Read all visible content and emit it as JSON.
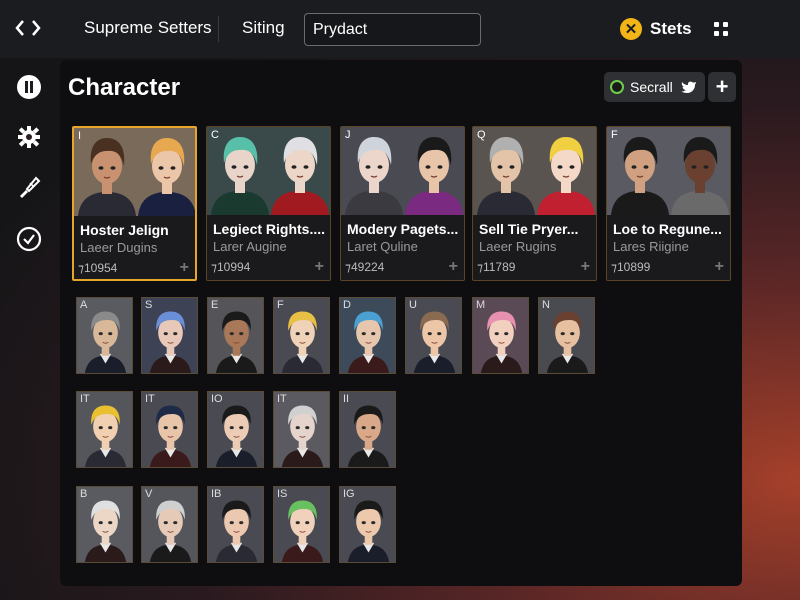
{
  "topbar": {
    "tabs": [
      {
        "label": "Supreme Setters"
      },
      {
        "label": "Siting"
      }
    ],
    "search_value": "Prydact",
    "stats_label": "Stets",
    "stats_icon": "x-circle-icon"
  },
  "sidebar": {
    "items": [
      {
        "icon": "pause-icon"
      },
      {
        "icon": "gear-icon"
      },
      {
        "icon": "brush-icon"
      },
      {
        "icon": "check-circle-icon"
      }
    ]
  },
  "panel": {
    "title": "Character",
    "search_chip_label": "Secrall",
    "add_label": "+"
  },
  "featured": [
    {
      "letter": "I",
      "title": "Hoster Jelign",
      "subtitle": "Laeer Dugins",
      "count": "⁊10954",
      "plus": "+"
    },
    {
      "letter": "C",
      "title": "Legiect Rights....",
      "subtitle": "Larer Augine",
      "count": "⁊10994",
      "plus": "+"
    },
    {
      "letter": "J",
      "title": "Modery Pagets...",
      "subtitle": "Laret Quline",
      "count": "⁊49224",
      "plus": "+"
    },
    {
      "letter": "Q",
      "title": "Sell Tie Pryer...",
      "subtitle": "Laeer Rugins",
      "count": "⁊11789",
      "plus": "+"
    },
    {
      "letter": "F",
      "title": "Loe to Regune...",
      "subtitle": "Lares Riigine",
      "count": "⁊10899",
      "plus": "+"
    }
  ],
  "roster_rows": [
    [
      {
        "letter": "A",
        "skin": "#d9b89a",
        "hair": "#8a8a8a",
        "bg": "#5a5b60"
      },
      {
        "letter": "S",
        "skin": "#e8c8b8",
        "hair": "#6a8fd6",
        "bg": "#3e4255"
      },
      {
        "letter": "E",
        "skin": "#a87858",
        "hair": "#1a1a1a",
        "bg": "#555459"
      },
      {
        "letter": "F",
        "skin": "#f0d2b8",
        "hair": "#e8c045",
        "bg": "#4a4b52"
      },
      {
        "letter": "D",
        "skin": "#e6c6ac",
        "hair": "#4aa0d0",
        "bg": "#3d4a5a"
      },
      {
        "letter": "U",
        "skin": "#ecc6a6",
        "hair": "#8a6a50",
        "bg": "#4a4b52"
      },
      {
        "letter": "M",
        "skin": "#f2d0c0",
        "hair": "#e890b0",
        "bg": "#5a4a55"
      },
      {
        "letter": "N",
        "skin": "#e6c0a0",
        "hair": "#6a4030",
        "bg": "#4a4b50"
      }
    ],
    [
      {
        "letter": "IT",
        "skin": "#f0d0b0",
        "hair": "#e8c030",
        "bg": "#55565c"
      },
      {
        "letter": "IT",
        "skin": "#e8c4a8",
        "hair": "#1e2a48",
        "bg": "#4a4b52"
      },
      {
        "letter": "IO",
        "skin": "#ecccb4",
        "hair": "#1a1a1a",
        "bg": "#4a4b52"
      },
      {
        "letter": "IT",
        "skin": "#e4d4cc",
        "hair": "#d0d0d0",
        "bg": "#5a5a60"
      },
      {
        "letter": "II",
        "skin": "#d8a888",
        "hair": "#1a1a1a",
        "bg": "#4a4b52"
      }
    ],
    [
      {
        "letter": "B",
        "skin": "#ecd6c6",
        "hair": "#e0e0e0",
        "bg": "#5a5b60"
      },
      {
        "letter": "V",
        "skin": "#e6cab8",
        "hair": "#cfcfcf",
        "bg": "#55565c"
      },
      {
        "letter": "IB",
        "skin": "#ecc8b0",
        "hair": "#1a1a1a",
        "bg": "#4a4b52"
      },
      {
        "letter": "IS",
        "skin": "#f0d2bc",
        "hair": "#68c060",
        "bg": "#4a4b52"
      },
      {
        "letter": "IG",
        "skin": "#ecc8ac",
        "hair": "#1a1a1a",
        "bg": "#4a4b52"
      }
    ]
  ],
  "colors": {
    "accent": "#e7a52a",
    "panel_bg": "#0e0e10",
    "topbar_bg": "#1b1c1f",
    "stats_icon_bg": "#f3b418"
  }
}
